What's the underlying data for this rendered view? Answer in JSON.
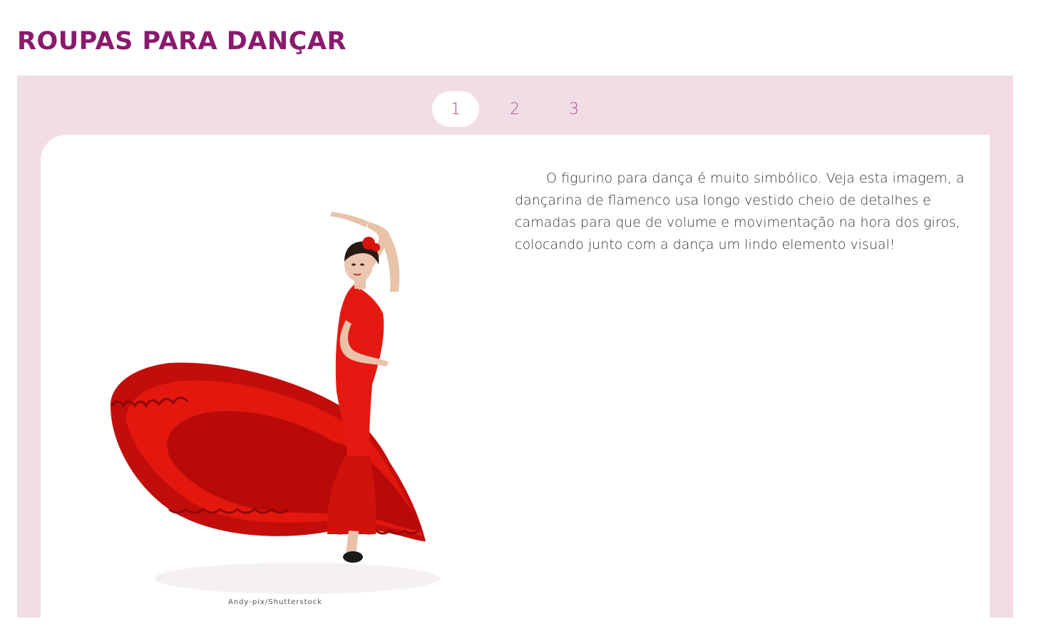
{
  "header": {
    "title": "ROUPAS PARA DANÇAR"
  },
  "tabs": [
    {
      "label": "1",
      "active": true
    },
    {
      "label": "2",
      "active": false
    },
    {
      "label": "3",
      "active": false
    }
  ],
  "content": {
    "paragraph": "O figurino para dança é muito simbólico. Veja esta imagem, a dançarina de flamenco usa longo vestido cheio de detalhes e camadas para que de volume e movimentação na hora dos giros, colocando junto com a dança um lindo elemento visual!",
    "image_credit": "Andy-pix/Shutterstock",
    "image_subject": "flamenco-dancer-red-dress"
  },
  "colors": {
    "title": "#8a1a6e",
    "panel_background": "#f2dde7",
    "tab_text": "#a0588a",
    "body_text": "#333333",
    "dress_red": "#e0150f"
  }
}
